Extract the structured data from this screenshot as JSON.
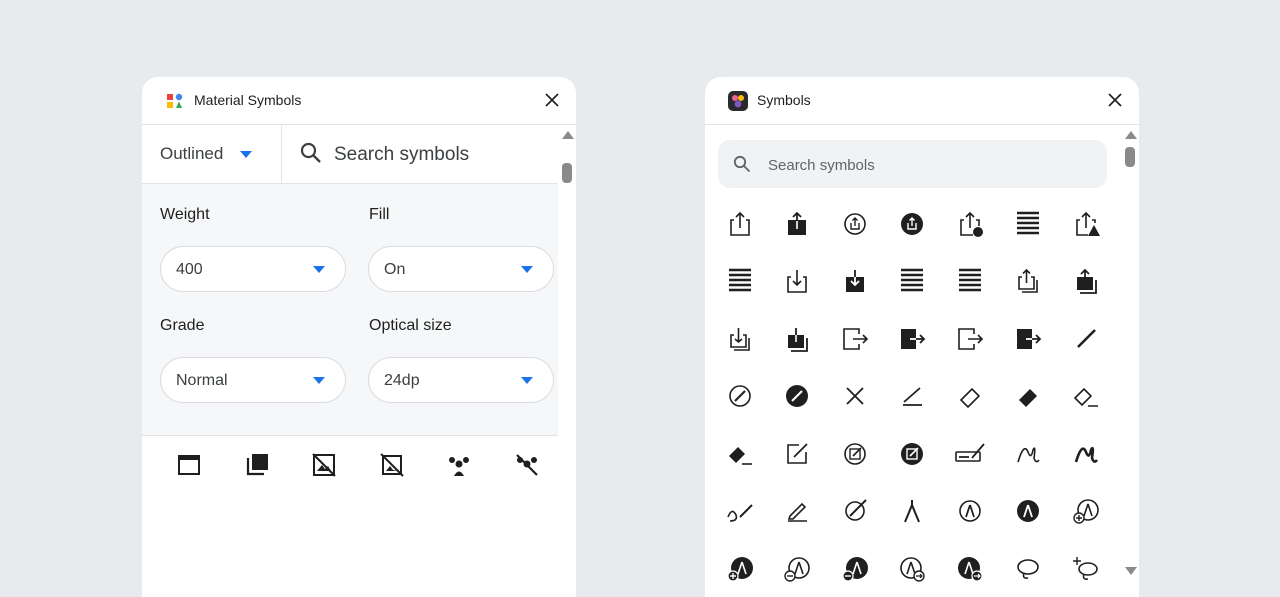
{
  "left_panel": {
    "title": "Material Symbols",
    "style_value": "Outlined",
    "search_placeholder": "Search symbols",
    "weight": {
      "label": "Weight",
      "value": "400"
    },
    "fill": {
      "label": "Fill",
      "value": "On"
    },
    "grade": {
      "label": "Grade",
      "value": "Normal"
    },
    "optical_size": {
      "label": "Optical size",
      "value": "24dp"
    },
    "icons": [
      "web-asset-icon",
      "library-icon",
      "hide-image-icon",
      "no-photography-icon",
      "groups-icon",
      "groups-off-icon",
      "android-icon",
      "add-icon",
      "plus-icon",
      "add-a-photo-icon",
      "add-to-queue-icon",
      "add-alert-icon"
    ]
  },
  "right_panel": {
    "title": "Symbols",
    "search_placeholder": "Search symbols",
    "icons": [
      "share-outline-icon",
      "share-filled-icon",
      "share-circle-icon",
      "share-circle-filled-icon",
      "share-clock-icon",
      "lines-icon",
      "share-warning-icon",
      "lines-icon",
      "download-outline-icon",
      "download-filled-icon",
      "lines-icon",
      "lines-icon",
      "share-stack-icon",
      "share-stack-filled-icon",
      "download-stack-icon",
      "download-stack-filled-icon",
      "exit-outline-icon",
      "exit-filled-icon",
      "exit-outline-icon",
      "exit-filled-icon",
      "pencil-icon",
      "pencil-circle-icon",
      "pencil-circle-filled-icon",
      "pencil-slash-icon",
      "pencil-line-icon",
      "eraser-icon",
      "eraser-filled-icon",
      "eraser-line-icon",
      "eraser-filled-line-icon",
      "square-pencil-icon",
      "circle-pencil-icon",
      "circle-pencil-filled-icon",
      "signature-pencil-icon",
      "scribble-icon",
      "scribble-bold-icon",
      "pencil-scribble-icon",
      "pencil-underline-icon",
      "pencil-slash-circle-icon",
      "compass-icon",
      "pen-circle-icon",
      "pen-circle-filled-icon",
      "pen-plus-icon",
      "pen-plus-filled-icon",
      "pen-minus-icon",
      "pen-minus-filled-icon",
      "pen-arrow-icon",
      "pen-arrow-filled-icon",
      "lasso-icon",
      "lasso-sparkle-icon"
    ]
  }
}
